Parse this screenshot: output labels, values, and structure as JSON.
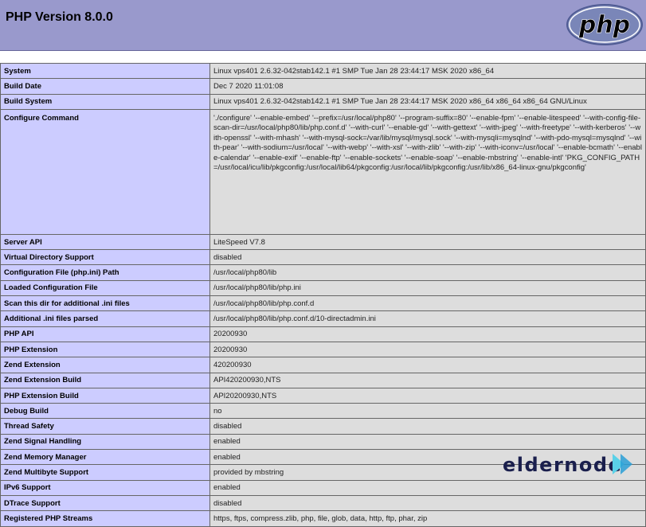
{
  "header": {
    "title": "PHP Version 8.0.0",
    "logo_text": "php",
    "colors": {
      "header_bg": "#9999cc",
      "label_cell_bg": "#ccccff",
      "value_cell_bg": "#dddddd"
    }
  },
  "rows": [
    {
      "label": "System",
      "value": "Linux vps401 2.6.32-042stab142.1 #1 SMP Tue Jan 28 23:44:17 MSK 2020 x86_64"
    },
    {
      "label": "Build Date",
      "value": "Dec 7 2020 11:01:08"
    },
    {
      "label": "Build System",
      "value": "Linux vps401 2.6.32-042stab142.1 #1 SMP Tue Jan 28 23:44:17 MSK 2020 x86_64 x86_64 x86_64 GNU/Linux"
    },
    {
      "label": "Configure Command",
      "value": "'./configure' '--enable-embed' '--prefix=/usr/local/php80' '--program-suffix=80' '--enable-fpm' '--enable-litespeed' '--with-config-file-scan-dir=/usr/local/php80/lib/php.conf.d' '--with-curl' '--enable-gd' '--with-gettext' '--with-jpeg' '--with-freetype' '--with-kerberos' '--with-openssl' '--with-mhash' '--with-mysql-sock=/var/lib/mysql/mysql.sock' '--with-mysqli=mysqlnd' '--with-pdo-mysql=mysqlnd' '--with-pear' '--with-sodium=/usr/local' '--with-webp' '--with-xsl' '--with-zlib' '--with-zip' '--with-iconv=/usr/local' '--enable-bcmath' '--enable-calendar' '--enable-exif' '--enable-ftp' '--enable-sockets' '--enable-soap' '--enable-mbstring' '--enable-intl' 'PKG_CONFIG_PATH=/usr/local/icu/lib/pkgconfig:/usr/local/lib64/pkgconfig:/usr/local/lib/pkgconfig:/usr/lib/x86_64-linux-gnu/pkgconfig'"
    },
    {
      "label": "Server API",
      "value": "LiteSpeed V7.8"
    },
    {
      "label": "Virtual Directory Support",
      "value": "disabled"
    },
    {
      "label": "Configuration File (php.ini) Path",
      "value": "/usr/local/php80/lib"
    },
    {
      "label": "Loaded Configuration File",
      "value": "/usr/local/php80/lib/php.ini"
    },
    {
      "label": "Scan this dir for additional .ini files",
      "value": "/usr/local/php80/lib/php.conf.d"
    },
    {
      "label": "Additional .ini files parsed",
      "value": "/usr/local/php80/lib/php.conf.d/10-directadmin.ini"
    },
    {
      "label": "PHP API",
      "value": "20200930"
    },
    {
      "label": "PHP Extension",
      "value": "20200930"
    },
    {
      "label": "Zend Extension",
      "value": "420200930"
    },
    {
      "label": "Zend Extension Build",
      "value": "API420200930,NTS"
    },
    {
      "label": "PHP Extension Build",
      "value": "API20200930,NTS"
    },
    {
      "label": "Debug Build",
      "value": "no"
    },
    {
      "label": "Thread Safety",
      "value": "disabled"
    },
    {
      "label": "Zend Signal Handling",
      "value": "enabled"
    },
    {
      "label": "Zend Memory Manager",
      "value": "enabled"
    },
    {
      "label": "Zend Multibyte Support",
      "value": "provided by mbstring"
    },
    {
      "label": "IPv6 Support",
      "value": "enabled"
    },
    {
      "label": "DTrace Support",
      "value": "disabled"
    },
    {
      "label": "Registered PHP Streams",
      "value": "https, ftps, compress.zlib, php, file, glob, data, http, ftp, phar, zip"
    }
  ],
  "watermark": {
    "text": "eldernode",
    "icon": "play-arrows-icon",
    "colors": {
      "text": "#1a1f4d",
      "arrow_light": "#5ad1e8",
      "arrow_dark": "#2a9fd6"
    }
  }
}
